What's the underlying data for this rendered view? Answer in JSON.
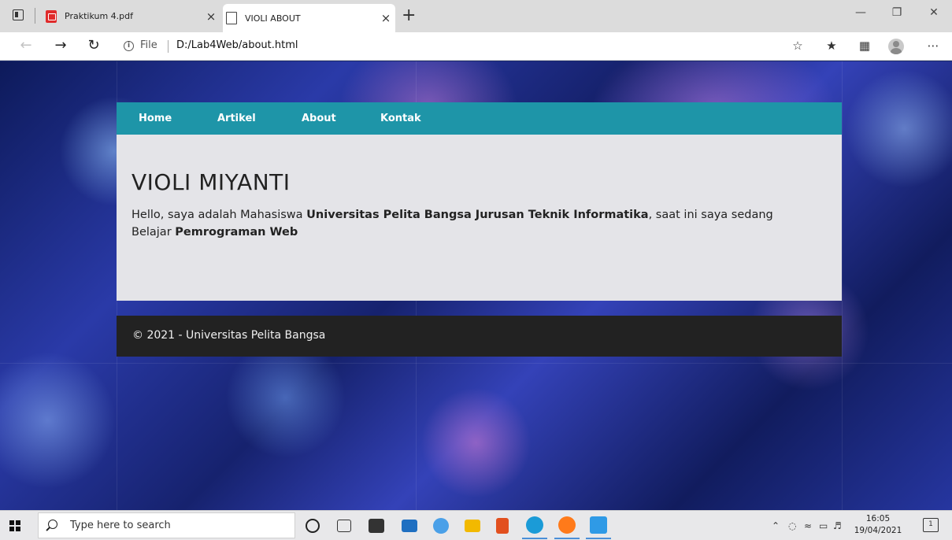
{
  "browser": {
    "tabs": [
      {
        "label": "Praktikum 4.pdf",
        "icon": "pdf-icon"
      },
      {
        "label": "VIOLI ABOUT",
        "icon": "document-icon"
      }
    ],
    "close_glyph": "×",
    "new_tab_glyph": "+",
    "address": {
      "scheme": "File",
      "url": "D:/Lab4Web/about.html"
    }
  },
  "page": {
    "nav": [
      "Home",
      "Artikel",
      "About",
      "Kontak"
    ],
    "title": "VIOLI MIYANTI",
    "intro_text_1": "Hello, saya adalah Mahasiswa ",
    "intro_bold_1": "Universitas Pelita Bangsa Jurusan Teknik Informatika",
    "intro_text_2": ", saat ini saya sedang Belajar ",
    "intro_bold_2": "Pemrograman Web",
    "footer": "© 2021 - Universitas Pelita Bangsa"
  },
  "taskbar": {
    "search_placeholder": "Type here to search",
    "time": "16:05",
    "date": "19/04/2021",
    "notification_count": "1"
  },
  "colors": {
    "nav_bg": "#1e95a8",
    "content_bg": "#e4e4e8",
    "footer_bg": "#222222"
  }
}
